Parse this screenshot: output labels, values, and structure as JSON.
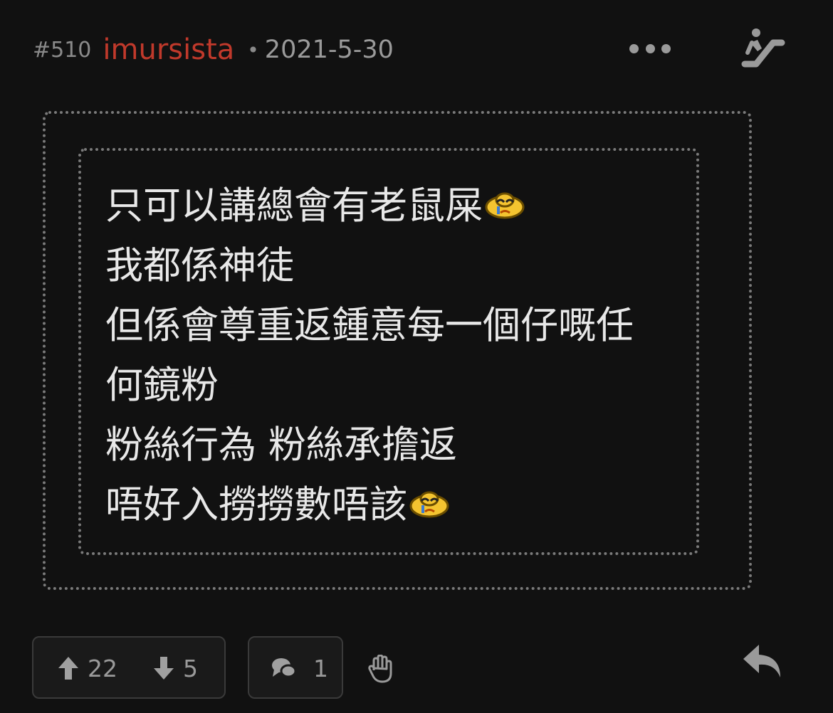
{
  "post": {
    "number": "#510",
    "username": "imursista",
    "separator": "•",
    "date": "2021-5-30"
  },
  "quote": {
    "lines": [
      "只可以講總會有老鼠屎",
      "我都係神徒",
      "但係會尊重返鍾意每一個仔嘅任",
      "何鏡粉",
      "粉絲行為 粉絲承擔返",
      "唔好入撈撈數唔該"
    ],
    "emoji": "crying-face-emoji"
  },
  "footer": {
    "upvotes": "22",
    "downvotes": "5",
    "comments": "1"
  },
  "icons": {
    "more": "more-dots-icon",
    "escalator": "escalator-icon",
    "upvote": "arrow-up-icon",
    "downvote": "arrow-down-icon",
    "comment": "speech-bubble-icon",
    "hand": "hand-icon",
    "reply": "reply-arrow-icon"
  },
  "colors": {
    "background": "#111111",
    "username": "#c0392b",
    "text": "#e8e8e8",
    "muted": "#9a9a9a"
  }
}
